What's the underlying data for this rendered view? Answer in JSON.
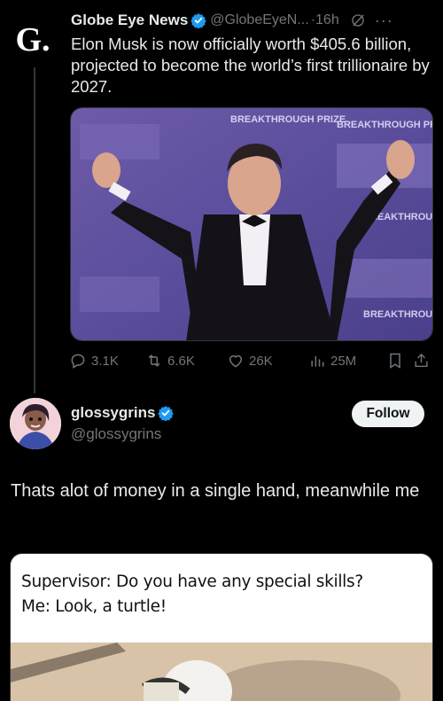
{
  "tweet": {
    "avatar_letter": "G.",
    "author_name": "Globe Eye News",
    "author_handle": "@GlobeEyeN...",
    "time": "·16h",
    "text": "Elon Musk is now officially worth $405.6 billion, projected to become the world’s first trillionaire by 2027.",
    "media_signs": [
      "BREAKTHROUGH PRIZE",
      "BREAKTHROUGH PRIZE",
      "BREAKTHROUGH PRIZE",
      "BREAKTHROUGH"
    ],
    "stats": {
      "replies": "3.1K",
      "reposts": "6.6K",
      "likes": "26K",
      "views": "25M"
    }
  },
  "reply": {
    "author_name": "glossygrins",
    "author_handle": "@glossygrins",
    "follow_label": "Follow",
    "text": "Thats alot of money in a single hand, meanwhile me",
    "meme_line1": "Supervisor: Do you have any special skills?",
    "meme_line2": "Me: Look, a turtle!"
  },
  "colors": {
    "background": "#000000",
    "text": "#e7e9ea",
    "secondary": "#71767b",
    "verified": "#1d9bf0"
  }
}
